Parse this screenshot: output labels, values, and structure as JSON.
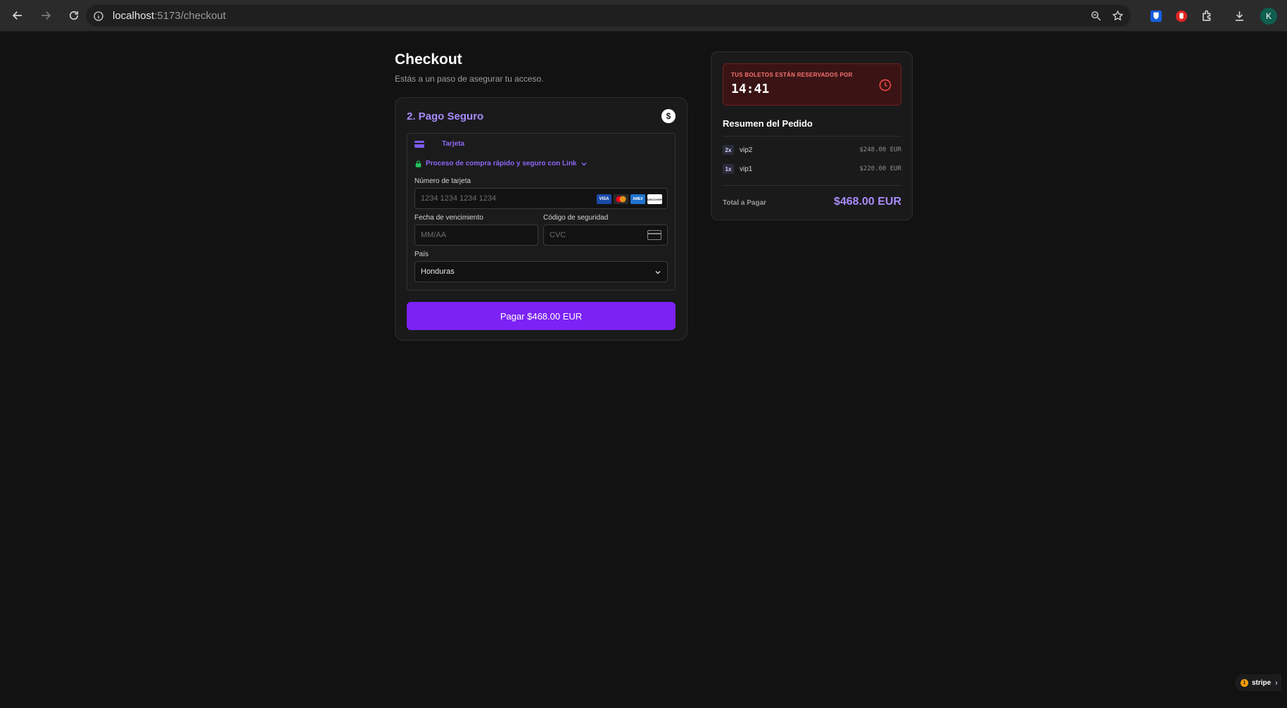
{
  "browser": {
    "url_host": "localhost",
    "url_path": ":5173/checkout",
    "avatar_initial": "K"
  },
  "checkout": {
    "title": "Checkout",
    "subtitle": "Estás a un paso de asegurar tu acceso.",
    "payment_heading": "2. Pago Seguro",
    "payment_tab_label": "Tarjeta",
    "link_text": "Proceso de compra rápido y seguro con Link",
    "card_number_label": "Número de tarjeta",
    "card_number_placeholder": "1234 1234 1234 1234",
    "expiry_label": "Fecha de vencimiento",
    "expiry_placeholder": "MM/AA",
    "cvc_label": "Código de seguridad",
    "cvc_placeholder": "CVC",
    "country_label": "País",
    "country_value": "Honduras",
    "pay_button_label": "Pagar $468.00 EUR",
    "card_brands": [
      "VISA",
      "MC",
      "AMEX",
      "DISCOVER"
    ]
  },
  "summary": {
    "timer_label": "TUS BOLETOS ESTÁN RESERVADOS POR",
    "timer_value": "14:41",
    "title": "Resumen del Pedido",
    "items": [
      {
        "qty": "2x",
        "name": "vip2",
        "price": "$248.00 EUR"
      },
      {
        "qty": "1x",
        "name": "vip1",
        "price": "$220.00 EUR"
      }
    ],
    "total_label": "Total a Pagar",
    "total_value": "$468.00 EUR"
  },
  "stripe_badge": {
    "count": "1",
    "label": "stripe"
  },
  "colors": {
    "accent": "#7c22f5",
    "accent_text": "#a78bfa",
    "timer_bg": "#3a1414",
    "timer_text": "#f87171",
    "lock_green": "#22c55e"
  }
}
